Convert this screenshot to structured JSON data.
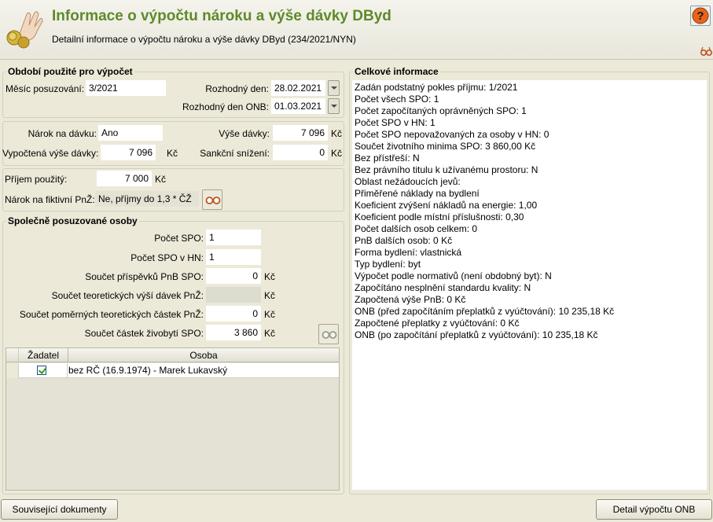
{
  "header": {
    "title": "Informace o výpočtu nároku a výše dávky DByd",
    "subtitle": "Detailní informace o výpočtu nároku a výše dávky DByd (234/2021/NYN)"
  },
  "period": {
    "legend": "Období použité pro výpočet",
    "month_label": "Měsíc posuzování:",
    "month_value": "3/2021",
    "decision_day_label": "Rozhodný den:",
    "decision_day_value": "28.02.2021",
    "decision_day_onb_label": "Rozhodný den ONB:",
    "decision_day_onb_value": "01.03.2021"
  },
  "claim": {
    "claim_label": "Nárok na dávku:",
    "claim_value": "Ano",
    "amount_label": "Výše dávky:",
    "amount_value": "7 096",
    "amount_unit": "Kč",
    "computed_label": "Vypočtená výše dávky:",
    "computed_value": "7 096",
    "computed_unit": "Kč",
    "sanction_label": "Sankční snížení:",
    "sanction_value": "0",
    "sanction_unit": "Kč"
  },
  "income": {
    "income_label": "Příjem použitý:",
    "income_value": "7 000",
    "income_unit": "Kč",
    "fictive_label": "Nárok na fiktivní PnŽ:",
    "fictive_value": "Ne, příjmy do 1,3 * ČŽ"
  },
  "persons": {
    "legend": "Společně posuzované osoby",
    "count_spo_label": "Počet SPO:",
    "count_spo_value": "1",
    "count_spo_hn_label": "Počet SPO v HN:",
    "count_spo_hn_value": "1",
    "sum_pnb_label": "Součet příspěvků PnB SPO:",
    "sum_pnb_value": "0",
    "sum_pnb_unit": "Kč",
    "sum_theor_label": "Součet teoretických výší dávek PnŽ:",
    "sum_theor_value": "",
    "sum_theor_unit": "Kč",
    "sum_prop_label": "Součet poměrných teoretických částek PnŽ:",
    "sum_prop_value": "0",
    "sum_prop_unit": "Kč",
    "sum_living_label": "Součet částek živobytí SPO:",
    "sum_living_value": "3 860",
    "sum_living_unit": "Kč",
    "table": {
      "columns": [
        "Žadatel",
        "Osoba"
      ],
      "rows": [
        {
          "applicant": true,
          "person": "bez RČ (16.9.1974) - Marek Lukavský"
        }
      ]
    }
  },
  "overall": {
    "legend": "Celkové informace",
    "lines": [
      "Zadán podstatný pokles příjmu: 1/2021",
      "Počet všech SPO: 1",
      "Počet započítaných oprávněných SPO: 1",
      "Počet SPO v HN: 1",
      "Počet SPO nepovažovaných za osoby v HN: 0",
      "Součet životního minima SPO: 3 860,00 Kč",
      "Bez přístřeší: N",
      "Bez právního titulu k užívanému prostoru: N",
      "Oblast nežádoucích jevů:",
      "Přiměřené náklady na bydlení",
      "Koeficient zvýšení nákladů na energie: 1,00",
      "Koeficient podle místní příslušnosti: 0,30",
      "Počet dalších osob celkem: 0",
      "PnB dalších osob: 0 Kč",
      "Forma bydlení: vlastnická",
      "Typ bydlení: byt",
      "Výpočet podle normativů (není obdobný byt): N",
      "Započítáno nesplnění standardu kvality: N",
      "Započtená výše PnB: 0 Kč",
      "ONB (před započítáním přeplatků z vyúčtování): 10 235,18 Kč",
      "Započtené přeplatky z vyúčtování: 0 Kč",
      "ONB (po započítání přeplatků z vyúčtování): 10 235,18 Kč"
    ]
  },
  "footer": {
    "related_docs_label": "Související dokumenty",
    "detail_onb_label": "Detail výpočtu ONB"
  },
  "colors": {
    "title_green": "#5e8a2a",
    "window_bg": "#ece9d8"
  }
}
